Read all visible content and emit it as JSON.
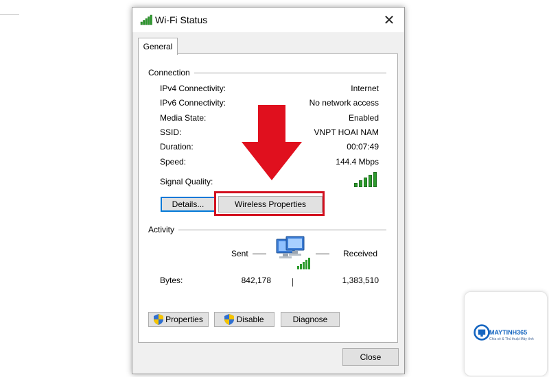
{
  "window": {
    "title": "Wi-Fi Status",
    "close_glyph": "✕"
  },
  "tabs": [
    {
      "label": "General"
    }
  ],
  "connection": {
    "group_label": "Connection",
    "rows": [
      {
        "label": "IPv4 Connectivity:",
        "value": "Internet"
      },
      {
        "label": "IPv6 Connectivity:",
        "value": "No network access"
      },
      {
        "label": "Media State:",
        "value": "Enabled"
      },
      {
        "label": "SSID:",
        "value": "VNPT HOAI NAM"
      },
      {
        "label": "Duration:",
        "value": "00:07:49"
      },
      {
        "label": "Speed:",
        "value": "144.4 Mbps"
      }
    ],
    "signal_label": "Signal Quality:",
    "signal_bars_filled": 5,
    "details_button": "Details...",
    "wireless_properties_button": "Wireless Properties"
  },
  "activity": {
    "group_label": "Activity",
    "sent_label": "Sent",
    "received_label": "Received",
    "bytes_label": "Bytes:",
    "bytes_sent": "842,178",
    "bytes_received": "1,383,510",
    "properties_button": "Properties",
    "disable_button": "Disable",
    "diagnose_button": "Diagnose"
  },
  "footer": {
    "close_button": "Close"
  },
  "watermark": {
    "brand": "MAYTINH365",
    "tagline": "Chia sẻ & Thủ thuật Máy tính"
  },
  "colors": {
    "highlight": "#d20f1e",
    "signal": "#2b9a2b",
    "focus": "#0078d7",
    "brand": "#1565c0"
  }
}
